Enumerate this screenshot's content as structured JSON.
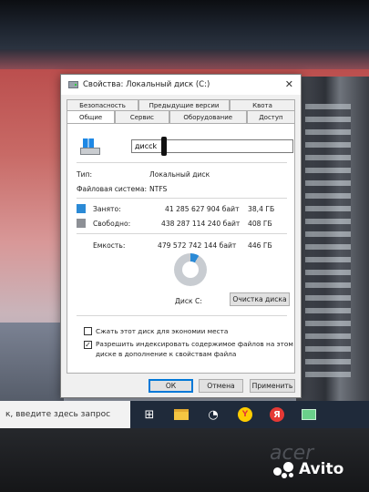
{
  "window": {
    "title": "Свойства: Локальный диск (C:)",
    "close_glyph": "✕"
  },
  "tabs": {
    "row1": [
      "Безопасность",
      "Предыдущие версии",
      "Квота"
    ],
    "row2": [
      "Общие",
      "Сервис",
      "Оборудование",
      "Доступ"
    ],
    "active": "Общие"
  },
  "general": {
    "name_value": "диссk",
    "type_label": "Тип:",
    "type_value": "Локальный диск",
    "fs_label": "Файловая система:",
    "fs_value": "NTFS",
    "used_label": "Занято:",
    "used_bytes": "41 285 627 904 байт",
    "used_size": "38,4 ГБ",
    "free_label": "Свободно:",
    "free_bytes": "438 287 114 240 байт",
    "free_size": "408 ГБ",
    "capacity_label": "Емкость:",
    "capacity_bytes": "479 572 742 144 байт",
    "capacity_size": "446 ГБ",
    "disk_label": "Диск C:",
    "cleanup_button": "Очистка диска",
    "used_fraction": 0.0861,
    "used_color": "#2b8ad6",
    "free_color": "#c8ccd1"
  },
  "options": {
    "compress_label": "Сжать этот диск для экономии места",
    "compress_checked": false,
    "index_label_line1": "Разрешить индексировать содержимое файлов на этом",
    "index_label_line2": "диске в дополнение к свойствам файла",
    "index_checked": true,
    "check_glyph": "✓"
  },
  "buttons": {
    "ok": "ОК",
    "cancel": "Отмена",
    "apply": "Применить"
  },
  "taskbar": {
    "search_placeholder": "к, введите здесь запрос",
    "icons": [
      "task-view-icon",
      "folder-icon",
      "steam-icon",
      "yandex-icon",
      "yandex-browser-icon",
      "app-icon"
    ]
  },
  "bezel": {
    "brand": "acer",
    "watermark": "Avito"
  }
}
